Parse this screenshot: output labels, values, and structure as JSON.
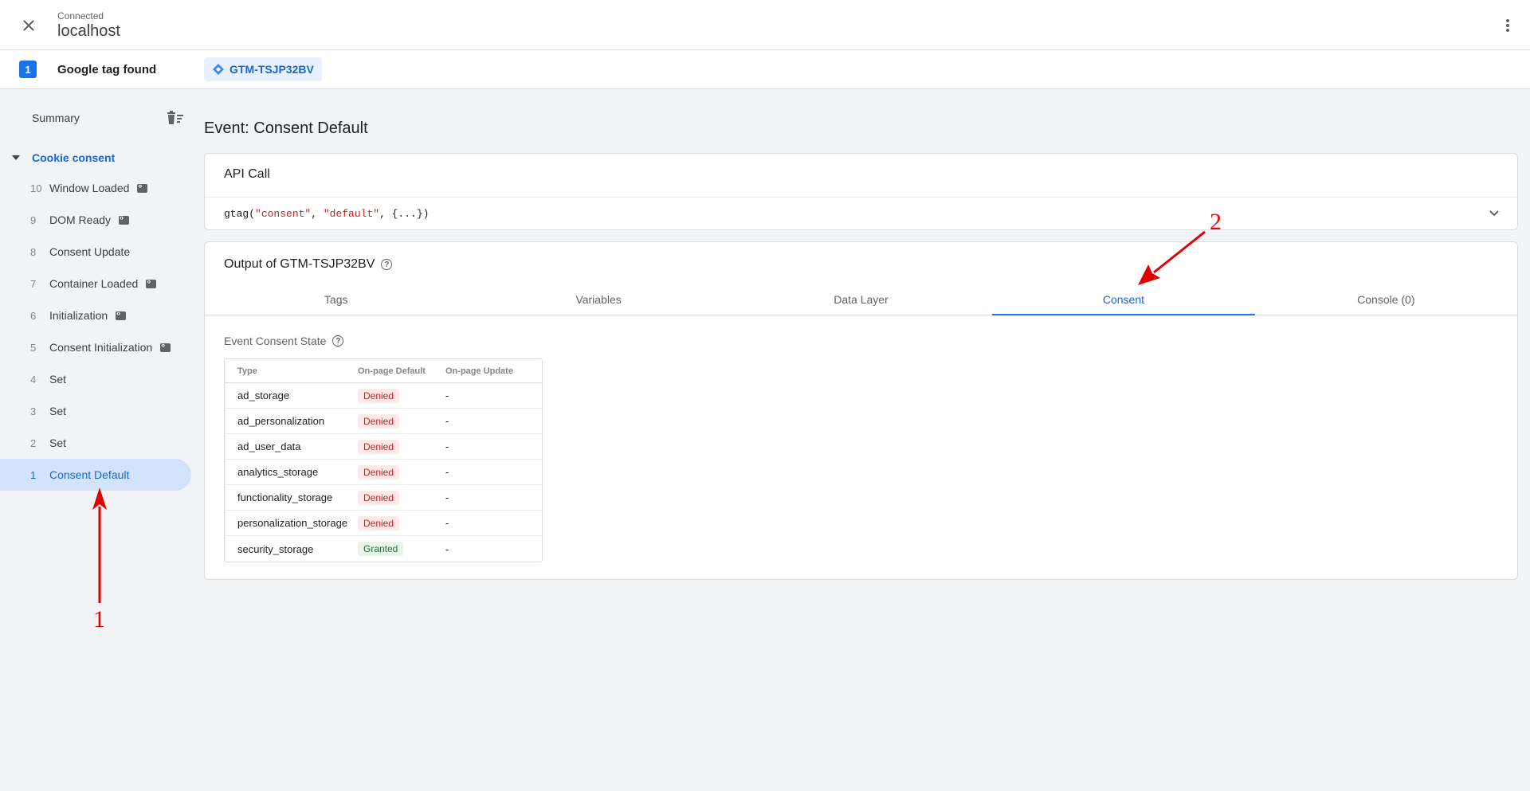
{
  "header": {
    "status": "Connected",
    "host": "localhost"
  },
  "tagbar": {
    "count": "1",
    "label": "Google tag found",
    "container_id": "GTM-TSJP32BV"
  },
  "sidebar": {
    "summary": "Summary",
    "group": "Cookie consent",
    "events": [
      {
        "num": "10",
        "label": "Window Loaded",
        "code": true
      },
      {
        "num": "9",
        "label": "DOM Ready",
        "code": true
      },
      {
        "num": "8",
        "label": "Consent Update",
        "code": false
      },
      {
        "num": "7",
        "label": "Container Loaded",
        "code": true
      },
      {
        "num": "6",
        "label": "Initialization",
        "code": true
      },
      {
        "num": "5",
        "label": "Consent Initialization",
        "code": true
      },
      {
        "num": "4",
        "label": "Set",
        "code": false
      },
      {
        "num": "3",
        "label": "Set",
        "code": false
      },
      {
        "num": "2",
        "label": "Set",
        "code": false
      },
      {
        "num": "1",
        "label": "Consent Default",
        "code": false
      }
    ]
  },
  "main": {
    "title": "Event: Consent Default",
    "api": {
      "title": "API Call",
      "code_prefix": "gtag(",
      "arg1": "\"consent\"",
      "sep": ", ",
      "arg2": "\"default\"",
      "code_suffix": ", {...})"
    },
    "output": {
      "title": "Output of GTM-TSJP32BV",
      "tabs": [
        "Tags",
        "Variables",
        "Data Layer",
        "Consent",
        "Console (0)"
      ],
      "active_tab": "Consent"
    },
    "consent": {
      "title": "Event Consent State",
      "headers": [
        "Type",
        "On-page Default",
        "On-page Update"
      ],
      "rows": [
        {
          "type": "ad_storage",
          "default": "Denied",
          "update": "-"
        },
        {
          "type": "ad_personalization",
          "default": "Denied",
          "update": "-"
        },
        {
          "type": "ad_user_data",
          "default": "Denied",
          "update": "-"
        },
        {
          "type": "analytics_storage",
          "default": "Denied",
          "update": "-"
        },
        {
          "type": "functionality_storage",
          "default": "Denied",
          "update": "-"
        },
        {
          "type": "personalization_storage",
          "default": "Denied",
          "update": "-"
        },
        {
          "type": "security_storage",
          "default": "Granted",
          "update": "-"
        }
      ]
    }
  },
  "annotations": {
    "label_1": "1",
    "label_2": "2"
  },
  "colors": {
    "accent": "#1a73e8",
    "annotation": "#e00000",
    "denied_bg": "#fce8e6",
    "granted_bg": "#e6f4ea"
  }
}
